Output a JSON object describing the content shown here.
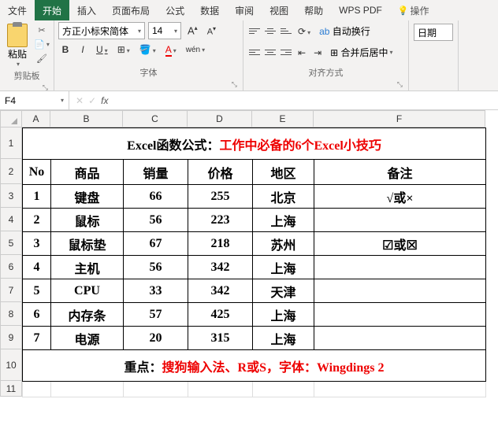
{
  "tabs": [
    "文件",
    "开始",
    "插入",
    "页面布局",
    "公式",
    "数据",
    "审阅",
    "视图",
    "帮助",
    "WPS PDF",
    "操作"
  ],
  "activeTab": 1,
  "ribbon": {
    "clipboard": {
      "paste": "粘贴",
      "label": "剪贴板"
    },
    "font": {
      "name": "方正小标宋简体",
      "size": "14",
      "increase": "A",
      "decrease": "A",
      "bold": "B",
      "italic": "I",
      "underline": "U",
      "label": "字体",
      "wen": "wén"
    },
    "align": {
      "wrap": "自动换行",
      "merge": "合并后居中",
      "label": "对齐方式"
    },
    "number": {
      "format": "日期"
    }
  },
  "nameBox": "F4",
  "formula": "",
  "cols": [
    "A",
    "B",
    "C",
    "D",
    "E",
    "F"
  ],
  "rowNums": [
    "1",
    "2",
    "3",
    "4",
    "5",
    "6",
    "7",
    "8",
    "9",
    "10",
    "11"
  ],
  "banner1": {
    "black": "Excel函数公式：",
    "red": "工作中必备的6个Excel小技巧"
  },
  "headers": [
    "No",
    "商品",
    "销量",
    "价格",
    "地区",
    "备注"
  ],
  "rows": [
    {
      "no": "1",
      "b": "键盘",
      "c": "66",
      "d": "255",
      "e": "北京",
      "f": "√或×"
    },
    {
      "no": "2",
      "b": "鼠标",
      "c": "56",
      "d": "223",
      "e": "上海",
      "f": ""
    },
    {
      "no": "3",
      "b": "鼠标垫",
      "c": "67",
      "d": "218",
      "e": "苏州",
      "f": "☑或☒"
    },
    {
      "no": "4",
      "b": "主机",
      "c": "56",
      "d": "342",
      "e": "上海",
      "f": ""
    },
    {
      "no": "5",
      "b": "CPU",
      "c": "33",
      "d": "342",
      "e": "天津",
      "f": ""
    },
    {
      "no": "6",
      "b": "内存条",
      "c": "57",
      "d": "425",
      "e": "上海",
      "f": ""
    },
    {
      "no": "7",
      "b": "电源",
      "c": "20",
      "d": "315",
      "e": "上海",
      "f": ""
    }
  ],
  "banner2": {
    "black": "重点：",
    "red": "搜狗输入法、R或S，字体：Wingdings 2"
  },
  "chart_data": {
    "type": "table",
    "title": "Excel函数公式：工作中必备的6个Excel小技巧",
    "columns": [
      "No",
      "商品",
      "销量",
      "价格",
      "地区",
      "备注"
    ],
    "data": [
      [
        1,
        "键盘",
        66,
        255,
        "北京",
        "√或×"
      ],
      [
        2,
        "鼠标",
        56,
        223,
        "上海",
        ""
      ],
      [
        3,
        "鼠标垫",
        67,
        218,
        "苏州",
        "☑或☒"
      ],
      [
        4,
        "主机",
        56,
        342,
        "上海",
        ""
      ],
      [
        5,
        "CPU",
        33,
        342,
        "天津",
        ""
      ],
      [
        6,
        "内存条",
        57,
        425,
        "上海",
        ""
      ],
      [
        7,
        "电源",
        20,
        315,
        "上海",
        ""
      ]
    ],
    "footnote": "重点：搜狗输入法、R或S，字体：Wingdings 2"
  }
}
